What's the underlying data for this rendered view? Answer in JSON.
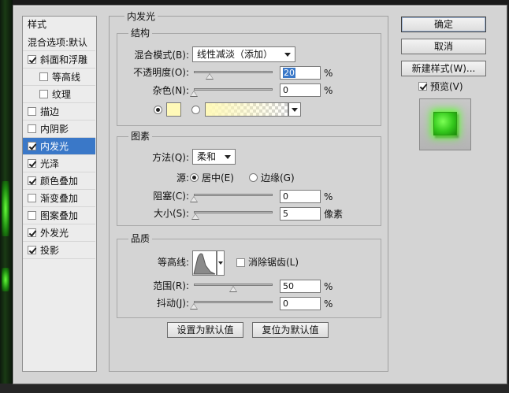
{
  "styles_panel": {
    "header": "样式",
    "items": [
      {
        "label": "混合选项:默认",
        "checkbox": false,
        "checked": false,
        "indent": false,
        "selected": false
      },
      {
        "label": "斜面和浮雕",
        "checkbox": true,
        "checked": true,
        "indent": false,
        "selected": false
      },
      {
        "label": "等高线",
        "checkbox": true,
        "checked": false,
        "indent": true,
        "selected": false
      },
      {
        "label": "纹理",
        "checkbox": true,
        "checked": false,
        "indent": true,
        "selected": false
      },
      {
        "label": "描边",
        "checkbox": true,
        "checked": false,
        "indent": false,
        "selected": false
      },
      {
        "label": "内阴影",
        "checkbox": true,
        "checked": false,
        "indent": false,
        "selected": false
      },
      {
        "label": "内发光",
        "checkbox": true,
        "checked": true,
        "indent": false,
        "selected": true
      },
      {
        "label": "光泽",
        "checkbox": true,
        "checked": true,
        "indent": false,
        "selected": false
      },
      {
        "label": "颜色叠加",
        "checkbox": true,
        "checked": true,
        "indent": false,
        "selected": false
      },
      {
        "label": "渐变叠加",
        "checkbox": true,
        "checked": false,
        "indent": false,
        "selected": false
      },
      {
        "label": "图案叠加",
        "checkbox": true,
        "checked": false,
        "indent": false,
        "selected": false
      },
      {
        "label": "外发光",
        "checkbox": true,
        "checked": true,
        "indent": false,
        "selected": false
      },
      {
        "label": "投影",
        "checkbox": true,
        "checked": true,
        "indent": false,
        "selected": false
      }
    ]
  },
  "inner_glow": {
    "title": "内发光",
    "structure": {
      "title": "结构",
      "blend_mode_label": "混合模式(B):",
      "blend_mode_value": "线性减淡（添加）",
      "opacity_label": "不透明度(O):",
      "opacity_value": "20",
      "opacity_fraction": 0.2,
      "noise_label": "杂色(N):",
      "noise_value": "0",
      "noise_fraction": 0,
      "percent": "%",
      "color_swatch": "#fff9b8",
      "gradient_from": "#fff9b8"
    },
    "elements": {
      "title": "图素",
      "technique_label": "方法(Q):",
      "technique_value": "柔和",
      "source_label": "源:",
      "source_center": "居中(E)",
      "source_edge": "边缘(G)",
      "choke_label": "阻塞(C):",
      "choke_value": "0",
      "choke_fraction": 0,
      "size_label": "大小(S):",
      "size_value": "5",
      "size_fraction": 0.02,
      "percent": "%",
      "pixels": "像素"
    },
    "quality": {
      "title": "品质",
      "contour_label": "等高线:",
      "anti_alias_label": "消除锯齿(L)",
      "range_label": "范围(R):",
      "range_value": "50",
      "range_fraction": 0.5,
      "jitter_label": "抖动(J):",
      "jitter_value": "0",
      "jitter_fraction": 0,
      "percent": "%"
    },
    "make_default": "设置为默认值",
    "reset_default": "复位为默认值"
  },
  "right": {
    "ok": "确定",
    "cancel": "取消",
    "new_style": "新建样式(W)...",
    "preview_label": "预览(V)",
    "preview_checked": true,
    "preview_color": "#3fd61f"
  }
}
